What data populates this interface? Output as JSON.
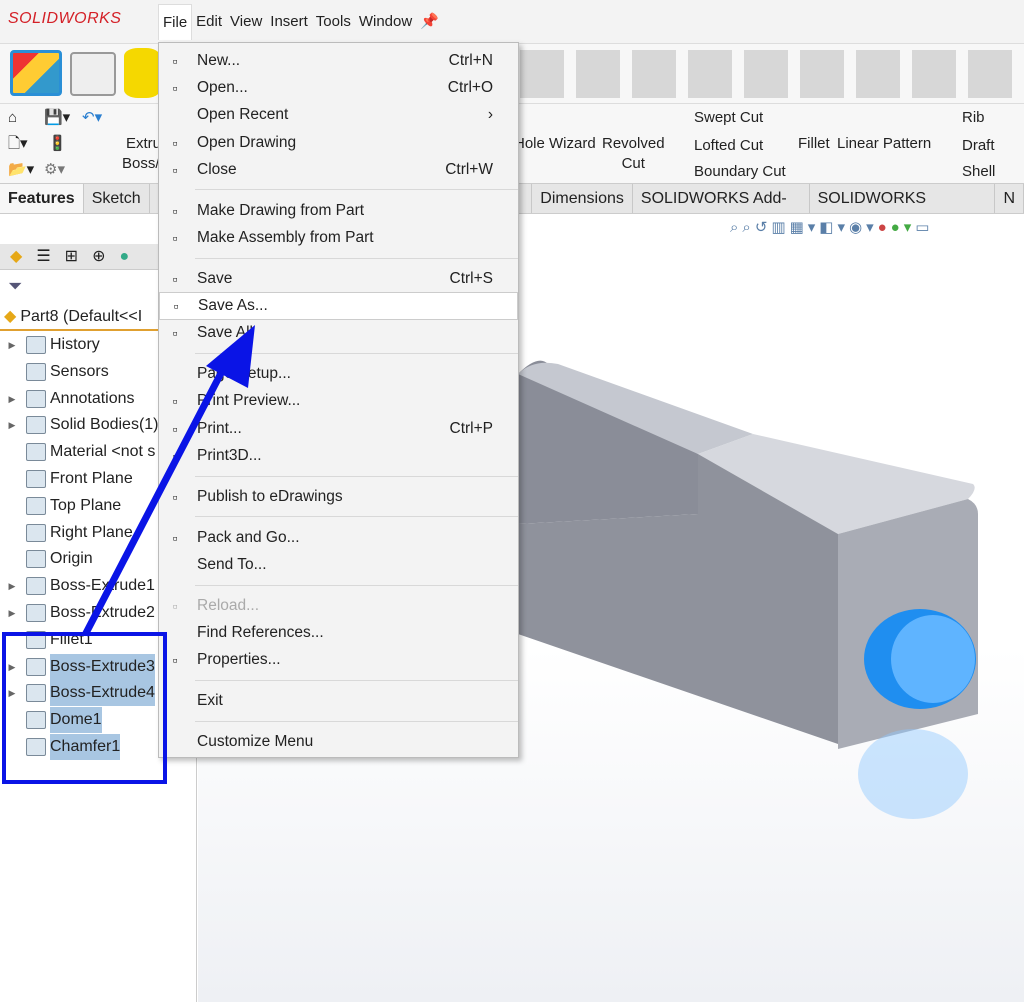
{
  "app": {
    "logo": "SOLIDWORKS"
  },
  "menubar": [
    "File",
    "Edit",
    "View",
    "Insert",
    "Tools",
    "Window"
  ],
  "ribbon": {
    "extrude": "Extru",
    "boss": "Boss/",
    "hole_wizard": "Hole Wizard",
    "revolved_cut": "Revolved",
    "revolved_cut2": "Cut",
    "swept_cut": "Swept Cut",
    "lofted_cut": "Lofted Cut",
    "boundary_cut": "Boundary Cut",
    "fillet": "Fillet",
    "linear_pattern": "Linear Pattern",
    "rib": "Rib",
    "draft": "Draft",
    "shell": "Shell"
  },
  "tabs": [
    "Features",
    "Sketch",
    "S",
    "Dimensions",
    "SOLIDWORKS Add-Ins",
    "SOLIDWORKS Visualize",
    "N"
  ],
  "tree": {
    "root": "Part8  (Default<<I",
    "items": [
      {
        "label": "History",
        "exp": true
      },
      {
        "label": "Sensors",
        "exp": false
      },
      {
        "label": "Annotations",
        "exp": true
      },
      {
        "label": "Solid Bodies(1)",
        "exp": true
      },
      {
        "label": "Material <not s",
        "exp": false
      },
      {
        "label": "Front Plane",
        "exp": false
      },
      {
        "label": "Top Plane",
        "exp": false
      },
      {
        "label": "Right Plane",
        "exp": false
      },
      {
        "label": "Origin",
        "exp": false
      },
      {
        "label": "Boss-Extrude1",
        "exp": true
      },
      {
        "label": "Boss-Extrude2",
        "exp": true
      },
      {
        "label": "Fillet1",
        "exp": false
      },
      {
        "label": "Boss-Extrude3",
        "exp": true,
        "sel": true
      },
      {
        "label": "Boss-Extrude4",
        "exp": true,
        "sel": true
      },
      {
        "label": "Dome1",
        "exp": false,
        "sel": true
      },
      {
        "label": "Chamfer1",
        "exp": false,
        "sel": true
      }
    ]
  },
  "file_menu": [
    {
      "label": "New...",
      "shortcut": "Ctrl+N",
      "icon": "new-document-icon"
    },
    {
      "label": "Open...",
      "shortcut": "Ctrl+O",
      "icon": "open-folder-icon"
    },
    {
      "label": "Open Recent",
      "shortcut": "›",
      "icon": ""
    },
    {
      "label": "Open Drawing",
      "shortcut": "",
      "icon": "open-drawing-icon"
    },
    {
      "label": "Close",
      "shortcut": "Ctrl+W",
      "icon": "close-document-icon"
    },
    {
      "sep": true
    },
    {
      "label": "Make Drawing from Part",
      "shortcut": "",
      "icon": "make-drawing-icon"
    },
    {
      "label": "Make Assembly from Part",
      "shortcut": "",
      "icon": "make-assembly-icon"
    },
    {
      "sep": true
    },
    {
      "label": "Save",
      "shortcut": "Ctrl+S",
      "icon": "save-icon"
    },
    {
      "label": "Save As...",
      "shortcut": "",
      "icon": "save-as-icon",
      "hl": true
    },
    {
      "label": "Save All",
      "shortcut": "",
      "icon": "save-all-icon"
    },
    {
      "sep": true
    },
    {
      "label": "Page Setup...",
      "shortcut": "",
      "icon": ""
    },
    {
      "label": "Print Preview...",
      "shortcut": "",
      "icon": "print-preview-icon"
    },
    {
      "label": "Print...",
      "shortcut": "Ctrl+P",
      "icon": "printer-icon"
    },
    {
      "label": "Print3D...",
      "shortcut": "",
      "icon": "print3d-icon"
    },
    {
      "sep": true
    },
    {
      "label": "Publish to eDrawings",
      "shortcut": "",
      "icon": "edrawings-icon"
    },
    {
      "sep": true
    },
    {
      "label": "Pack and Go...",
      "shortcut": "",
      "icon": "pack-and-go-icon"
    },
    {
      "label": "Send To...",
      "shortcut": "",
      "icon": ""
    },
    {
      "sep": true
    },
    {
      "label": "Reload...",
      "shortcut": "",
      "icon": "reload-icon",
      "dis": true
    },
    {
      "label": "Find References...",
      "shortcut": "",
      "icon": ""
    },
    {
      "label": "Properties...",
      "shortcut": "",
      "icon": "properties-icon"
    },
    {
      "sep": true
    },
    {
      "label": "Exit",
      "shortcut": "",
      "icon": ""
    },
    {
      "sep": true
    },
    {
      "label": "Customize Menu",
      "shortcut": "",
      "icon": ""
    }
  ],
  "colors": {
    "annotation": "#0a14e6",
    "selection": "#a8c6e2",
    "brand": "#d42027"
  }
}
